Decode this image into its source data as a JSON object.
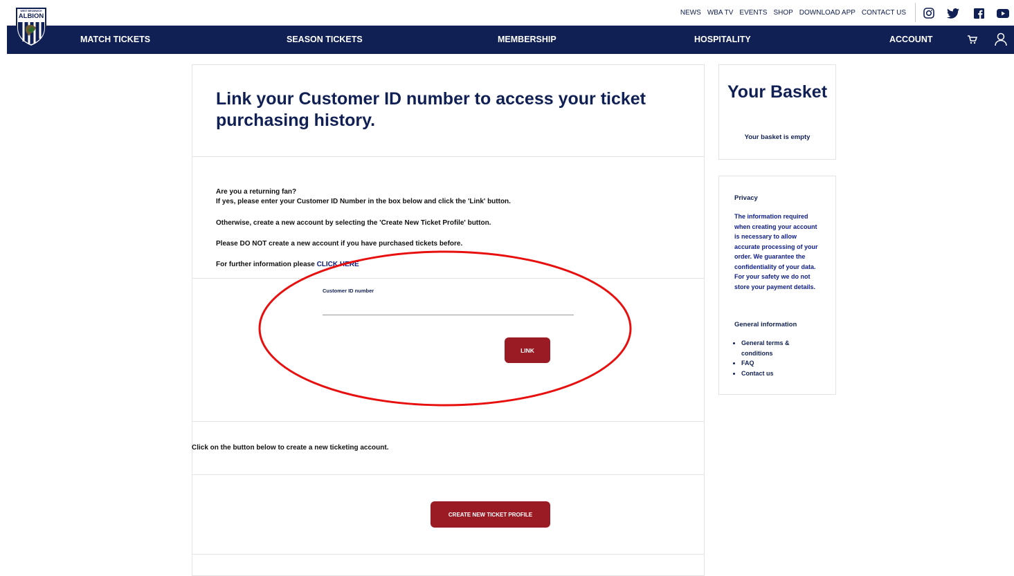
{
  "header": {
    "logo_alt": "West Bromwich Albion",
    "logo_top_text": "WEST BROMWICH",
    "logo_main_text": "ALBION",
    "utility_links": [
      "NEWS",
      "WBA TV",
      "EVENTS",
      "SHOP",
      "DOWNLOAD APP",
      "CONTACT US"
    ],
    "social_icons": [
      "instagram-icon",
      "twitter-icon",
      "facebook-icon",
      "youtube-icon"
    ]
  },
  "nav": {
    "items": [
      "MATCH TICKETS",
      "SEASON TICKETS",
      "MEMBERSHIP",
      "HOSPITALITY",
      "ACCOUNT"
    ],
    "icons": [
      "cart-icon",
      "user-icon"
    ]
  },
  "main": {
    "title": "Link your Customer ID number to access your ticket purchasing history.",
    "intro": {
      "line1": "Are you a returning fan?",
      "line2": "If yes, please enter your Customer ID Number in the box below and click the 'Link' button.",
      "line3": "Otherwise, create a new account by selecting the 'Create New Ticket Profile' button.",
      "line4": "Please DO NOT create a new account if you have purchased tickets before.",
      "line5_prefix": "For further information please ",
      "line5_link": "CLICK HERE"
    },
    "form": {
      "label": "Customer ID number",
      "value": "",
      "placeholder": "",
      "button": "LINK"
    },
    "create": {
      "text": "Click on the button below to create a new ticketing account.",
      "button": "CREATE NEW TICKET PROFILE"
    }
  },
  "sidebar": {
    "basket": {
      "title": "Your Basket",
      "empty_text": "Your basket is empty"
    },
    "privacy": {
      "heading": "Privacy",
      "text": "The information required when creating your account is necessary to allow accurate processing of your order. We guarantee the confidentiality of your data. For your safety we do not store your payment details."
    },
    "general": {
      "heading": "General information",
      "links": [
        "General terms & conditions",
        "FAQ",
        "Contact us"
      ]
    }
  },
  "colors": {
    "navy": "#102054",
    "button_red": "#9b1b25",
    "annotation_red": "#e8100f",
    "border": "#e3e3e3"
  }
}
